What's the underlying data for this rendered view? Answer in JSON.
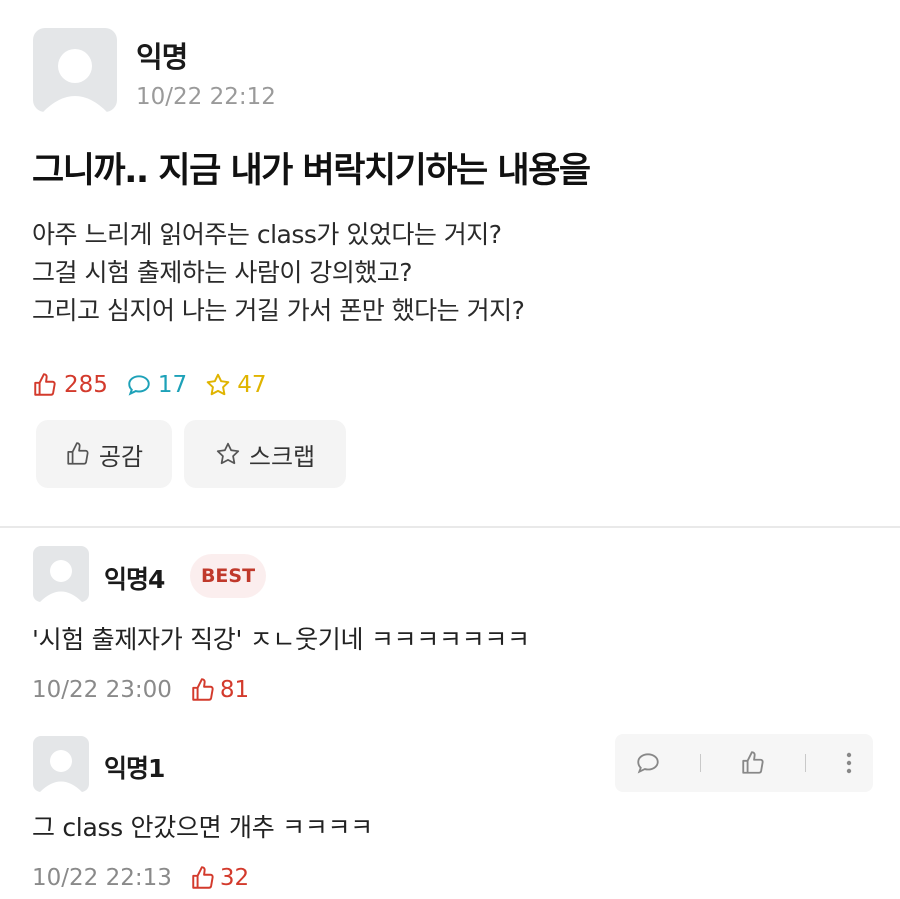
{
  "post": {
    "author": "익명",
    "time": "10/22 22:12",
    "title": "그니까.. 지금 내가 벼락치기하는 내용을",
    "body": [
      "아주 느리게 읽어주는 class가 있었다는 거지?",
      "그걸 시험 출제하는 사람이 강의했고?",
      "그리고 심지어 나는 거길 가서 폰만 했다는 거지?"
    ],
    "stats": {
      "likes": "285",
      "comments": "17",
      "scraps": "47"
    },
    "buttons": {
      "like_label": "공감",
      "scrap_label": "스크랩"
    }
  },
  "comments": [
    {
      "author": "익명4",
      "badge": "BEST",
      "text": "'시험 출제자가 직강' ㅈㄴ웃기네 ㅋㅋㅋㅋㅋㅋㅋ",
      "time": "10/22 23:00",
      "likes": "81"
    },
    {
      "author": "익명1",
      "text": "그 class 안갔으면 개추 ㅋㅋㅋㅋ",
      "time": "10/22 22:13",
      "likes": "32"
    }
  ],
  "colors": {
    "like": "#d33a2c",
    "comment": "#1da1b8",
    "scrap": "#e0b400",
    "best_badge_bg": "#fbeeee",
    "best_badge_text": "#c0392b"
  },
  "icons": [
    "avatar-icon",
    "thumbs-up-icon",
    "speech-bubble-icon",
    "star-icon",
    "more-vertical-icon"
  ]
}
